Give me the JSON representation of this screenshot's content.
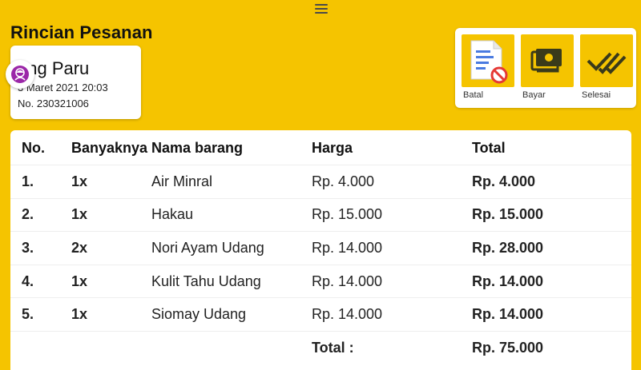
{
  "header": {
    "title": "Rincian Pesanan"
  },
  "customer": {
    "name": "ang Paru",
    "datetime": "3 Maret 2021 20:03",
    "number": "No. 230321006"
  },
  "actions": [
    {
      "label": "Batal",
      "icon": "cancel-document-icon"
    },
    {
      "label": "Bayar",
      "icon": "cash-icon"
    },
    {
      "label": "Selesai",
      "icon": "double-check-icon"
    }
  ],
  "table": {
    "headers": {
      "no": "No.",
      "qty": "Banyaknya",
      "name": "Nama barang",
      "price": "Harga",
      "total": "Total"
    },
    "rows": [
      {
        "no": "1.",
        "qty": "1x",
        "name": "Air Minral",
        "price": "Rp. 4.000",
        "total": "Rp. 4.000"
      },
      {
        "no": "2.",
        "qty": "1x",
        "name": "Hakau",
        "price": "Rp. 15.000",
        "total": "Rp. 15.000"
      },
      {
        "no": "3.",
        "qty": "2x",
        "name": "Nori Ayam Udang",
        "price": "Rp. 14.000",
        "total": "Rp. 28.000"
      },
      {
        "no": "4.",
        "qty": "1x",
        "name": "Kulit Tahu Udang",
        "price": "Rp. 14.000",
        "total": "Rp. 14.000"
      },
      {
        "no": "5.",
        "qty": "1x",
        "name": "Siomay Udang",
        "price": "Rp. 14.000",
        "total": "Rp. 14.000"
      }
    ],
    "footer": {
      "label": "Total :",
      "value": "Rp. 75.000"
    }
  },
  "colors": {
    "background": "#f5c400",
    "avatar": "#9b27a8",
    "cancel": "#e53935",
    "doc": "#4a7be0"
  }
}
